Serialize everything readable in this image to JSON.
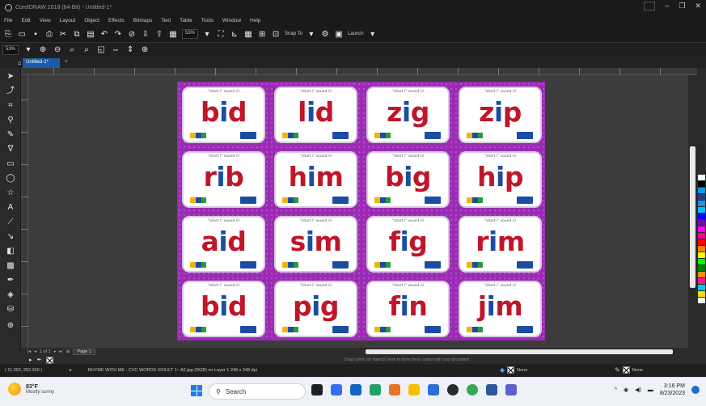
{
  "window": {
    "title": "CorelDRAW 2018 (64-Bit) - Untitled-1*"
  },
  "menu": [
    "File",
    "Edit",
    "View",
    "Layout",
    "Object",
    "Effects",
    "Bitmaps",
    "Text",
    "Table",
    "Tools",
    "Window",
    "Help"
  ],
  "toolbar": {
    "zoom_value": "53%",
    "snap_label": "Snap To",
    "launch_label": "Launch"
  },
  "propbar": {
    "zoom_value": "53%"
  },
  "doc_tab": {
    "label": "Untitled-1*"
  },
  "cards": [
    {
      "hint": "\"short i\" sound /i/",
      "pre": "b",
      "vowel": "i",
      "post": "d"
    },
    {
      "hint": "\"short i\" sound /i/",
      "pre": "l",
      "vowel": "i",
      "post": "d"
    },
    {
      "hint": "\"short i\" sound /i/",
      "pre": "z",
      "vowel": "i",
      "post": "g"
    },
    {
      "hint": "\"short i\" sound /i/",
      "pre": "z",
      "vowel": "i",
      "post": "p"
    },
    {
      "hint": "\"short i\" sound /i/",
      "pre": "r",
      "vowel": "i",
      "post": "b"
    },
    {
      "hint": "\"short i\" sound /i/",
      "pre": "h",
      "vowel": "i",
      "post": "m"
    },
    {
      "hint": "\"short i\" sound /i/",
      "pre": "b",
      "vowel": "i",
      "post": "g"
    },
    {
      "hint": "\"short i\" sound /i/",
      "pre": "h",
      "vowel": "i",
      "post": "p"
    },
    {
      "hint": "\"short i\" sound /i/",
      "pre": "a",
      "vowel": "i",
      "post": "d"
    },
    {
      "hint": "\"short i\" sound /i/",
      "pre": "s",
      "vowel": "i",
      "post": "m"
    },
    {
      "hint": "\"short i\" sound /i/",
      "pre": "f",
      "vowel": "i",
      "post": "g"
    },
    {
      "hint": "\"short i\" sound /i/",
      "pre": "r",
      "vowel": "i",
      "post": "m"
    },
    {
      "hint": "\"short i\" sound /i/",
      "pre": "b",
      "vowel": "i",
      "post": "d"
    },
    {
      "hint": "\"short i\" sound /i/",
      "pre": "p",
      "vowel": "i",
      "post": "g"
    },
    {
      "hint": "\"short i\" sound /i/",
      "pre": "f",
      "vowel": "i",
      "post": "n"
    },
    {
      "hint": "\"short i\" sound /i/",
      "pre": "j",
      "vowel": "i",
      "post": "m"
    }
  ],
  "pagenav": {
    "counter": "1 of 1",
    "page_tab": "Page 1"
  },
  "hint_bar": {
    "text": "Drag colors (or objects) here to store these colors with your document"
  },
  "status": {
    "coords": "( 11.392, 252.300 )",
    "doc_info": "RHYME WITH ME - CVC WORDS VIOLET 1~ A2.jpg (RGB) on Layer 1 248 x 248 dpi",
    "fill_label": "None",
    "stroke_label": "None"
  },
  "taskbar": {
    "weather_temp": "83°F",
    "weather_cond": "Mostly sunny",
    "search_label": "Search",
    "time": "3:16 PM",
    "date": "8/23/2023"
  },
  "colors": {
    "page_bg": "#9b2bb5",
    "word_consonant": "#c0162a",
    "word_vowel": "#1b4ea3",
    "doc_tab": "#1e5aa8"
  },
  "palette": [
    "#ffffff",
    "#000000",
    "#00a0e0",
    "#2b3a8f",
    "#1e90ff",
    "#00c0ff",
    "#0000ff",
    "#6a0dad",
    "#ff00ff",
    "#ff0090",
    "#ff0000",
    "#ff7f00",
    "#ffff00",
    "#00ff00",
    "#008000",
    "#ff8c00",
    "#ff1493",
    "#00ced1",
    "#ffd700",
    "#ffffff"
  ]
}
